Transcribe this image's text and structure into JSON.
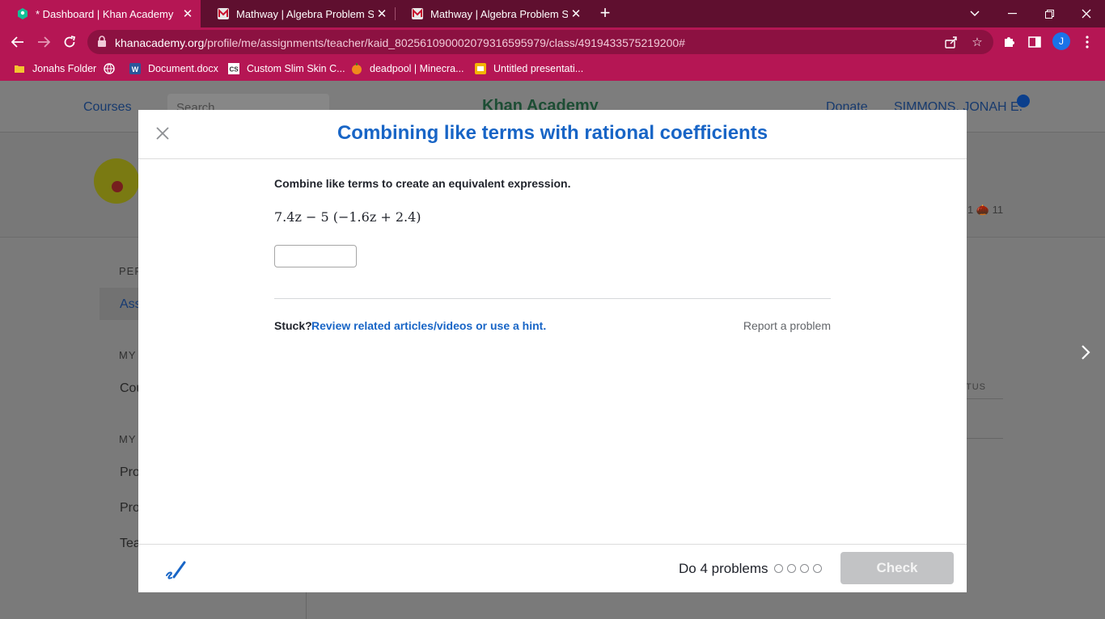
{
  "browser": {
    "tabs": [
      {
        "title": "* Dashboard | Khan Academy",
        "active": true
      },
      {
        "title": "Mathway | Algebra Problem Solv"
      },
      {
        "title": "Mathway | Algebra Problem Solv"
      }
    ],
    "new_tab_label": "+",
    "url_host": "khanacademy.org",
    "url_path": "/profile/me/assignments/teacher/kaid_802561090002079316595979/class/4919433575219200#",
    "profile_initial": "J",
    "bookmarks": [
      {
        "label": "Jonahs Folder",
        "icon": "folder-icon"
      },
      {
        "label": "",
        "icon": "globe-icon"
      },
      {
        "label": "Document.docx",
        "icon": "word-icon"
      },
      {
        "label": "Custom Slim Skin C...",
        "icon": "cs-icon"
      },
      {
        "label": "deadpool | Minecra...",
        "icon": "pumpkin-icon"
      },
      {
        "label": "Untitled presentati...",
        "icon": "slides-icon"
      }
    ],
    "accent": "#b51654",
    "tabstrip_color": "#5f0f2f"
  },
  "background_page": {
    "courses": "Courses",
    "search_placeholder": "Search",
    "logo_text": "Khan Academy",
    "donate": "Donate",
    "user_name": "SIMMONS, JONAH E.",
    "stat_text": "1 🌰 11",
    "sidebar_section_1": "PER",
    "sidebar_selected": "Ass",
    "sidebar_section_2": "MY",
    "sidebar_link_1": "Cou",
    "sidebar_section_3": "MY",
    "sidebar_link_2": "Pro",
    "sidebar_link_3": "Pro",
    "sidebar_link_4": "Tea",
    "status_header": "TUS"
  },
  "modal": {
    "title": "Combining like terms with rational coefficients",
    "prompt": "Combine like terms to create an equivalent expression.",
    "expression": "7.4z − 5 (−1.6z + 2.4)",
    "answer_value": "",
    "stuck_label": "Stuck?",
    "hint_link": "Review related articles/videos or use a hint.",
    "report_link": "Report a problem",
    "do_problems": "Do 4 problems",
    "problem_progress": {
      "completed": 0,
      "total": 4
    },
    "check_label": "Check",
    "title_color": "#1865c6"
  }
}
